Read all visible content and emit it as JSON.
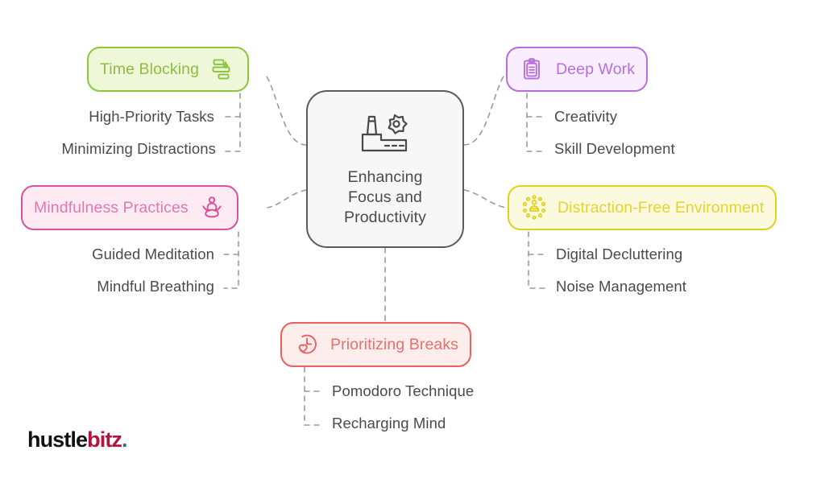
{
  "diagram": {
    "type": "mind-map",
    "center": {
      "label": "Enhancing\nFocus and\nProductivity",
      "label_line1": "Enhancing",
      "label_line2": "Focus and",
      "label_line3": "Productivity",
      "icon": "factory-gear-icon",
      "border_color": "#5b5b5b",
      "fill_color": "#f7f7f7",
      "text_color": "#4a4a4a"
    },
    "branches": [
      {
        "id": "time-blocking",
        "label": "Time Blocking",
        "icon": "gantt-chart-icon",
        "icon_side": "right",
        "border_color": "#8cc63f",
        "fill_color": "#eef7d8",
        "text_color": "#8cbe3f",
        "children": [
          {
            "label": "High-Priority Tasks"
          },
          {
            "label": "Minimizing Distractions"
          }
        ]
      },
      {
        "id": "deep-work",
        "label": "Deep Work",
        "icon": "clipboard-list-icon",
        "icon_side": "left",
        "border_color": "#b86fdd",
        "fill_color": "#f8eefd",
        "text_color": "#b86fdd",
        "children": [
          {
            "label": "Creativity"
          },
          {
            "label": "Skill Development"
          }
        ]
      },
      {
        "id": "mindfulness-practices",
        "label": "Mindfulness Practices",
        "icon": "meditation-person-icon",
        "icon_side": "right",
        "border_color": "#d6559a",
        "fill_color": "#fdeaf3",
        "text_color": "#e07aae",
        "children": [
          {
            "label": "Guided Meditation"
          },
          {
            "label": "Mindful Breathing"
          }
        ]
      },
      {
        "id": "distraction-free-environment",
        "label": "Distraction-Free Environment",
        "icon": "focused-person-rays-icon",
        "icon_side": "left",
        "border_color": "#e0d21a",
        "fill_color": "#fbfadf",
        "text_color": "#e3d430",
        "children": [
          {
            "label": "Digital Decluttering"
          },
          {
            "label": "Noise Management"
          }
        ]
      },
      {
        "id": "prioritizing-breaks",
        "label": "Prioritizing Breaks",
        "icon": "clock-heart-icon",
        "icon_side": "left",
        "border_color": "#e8615f",
        "fill_color": "#fdeeec",
        "text_color": "#e8706d",
        "children": [
          {
            "label": "Pomodoro Technique"
          },
          {
            "label": "Recharging Mind"
          }
        ]
      }
    ],
    "connector_style": {
      "color": "#9a9a9a",
      "dash": "6 6",
      "width": 1.6
    }
  },
  "logo": {
    "part1": "hustle",
    "part2": "bitz",
    "part3": ".",
    "part1_color": "#111111",
    "part2_color": "#b5123e",
    "part3_color": "#2f6f8f"
  }
}
